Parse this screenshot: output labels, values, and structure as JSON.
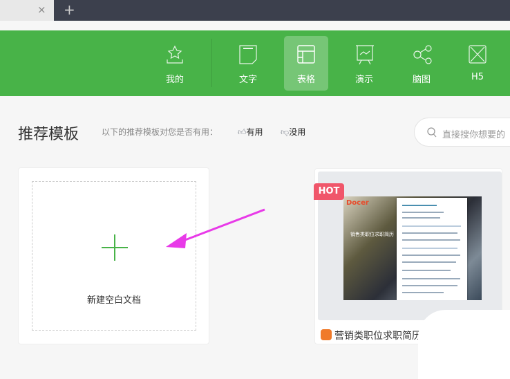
{
  "tabbar": {
    "close": "×",
    "new_tab": "+"
  },
  "nav": {
    "items": [
      {
        "label": "我的",
        "icon": "star-icon"
      },
      {
        "label": "文字",
        "icon": "document-icon"
      },
      {
        "label": "表格",
        "icon": "table-icon",
        "active": true
      },
      {
        "label": "演示",
        "icon": "presentation-icon"
      },
      {
        "label": "脑图",
        "icon": "mindmap-icon"
      },
      {
        "label": "H5",
        "icon": "h5-icon"
      }
    ]
  },
  "section": {
    "title": "推荐模板",
    "hint": "以下的推荐模板对您是否有用：",
    "useful": "有用",
    "useless": "没用"
  },
  "search": {
    "placeholder": "直接搜你想要的"
  },
  "new_doc": {
    "label": "新建空白文档"
  },
  "template": {
    "badge": "HOT",
    "name": "营销类职位求职简历",
    "image_text": "销售类职位求职简历",
    "logo": "Docer"
  },
  "colors": {
    "brand": "#48b348",
    "hot": "#f0566a",
    "arrow": "#e83ae8"
  }
}
